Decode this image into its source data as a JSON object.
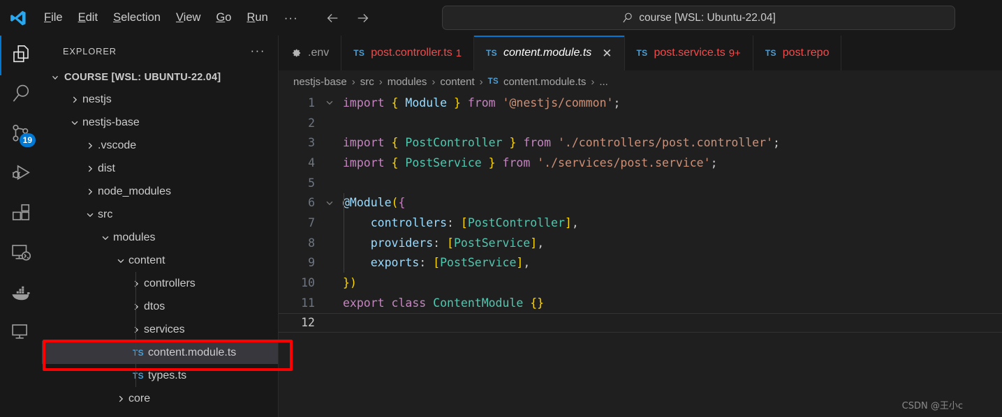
{
  "titlebar": {
    "logo_icon": "vscode-logo-icon",
    "menu": [
      {
        "label": "File",
        "access_key": "F"
      },
      {
        "label": "Edit",
        "access_key": "E"
      },
      {
        "label": "Selection",
        "access_key": "S"
      },
      {
        "label": "View",
        "access_key": "V"
      },
      {
        "label": "Go",
        "access_key": "G"
      },
      {
        "label": "Run",
        "access_key": "R"
      }
    ],
    "overflow_label": "···",
    "back_icon": "arrow-left-icon",
    "forward_icon": "arrow-right-icon",
    "command_center": {
      "search_icon": "search-icon",
      "text": "course [WSL: Ubuntu-22.04]"
    }
  },
  "activity_bar": {
    "items": [
      {
        "name": "explorer",
        "icon": "files-icon",
        "active": true,
        "badge": ""
      },
      {
        "name": "search",
        "icon": "search-icon",
        "active": false,
        "badge": ""
      },
      {
        "name": "source-control",
        "icon": "source-control-icon",
        "active": false,
        "badge": "19"
      },
      {
        "name": "run-and-debug",
        "icon": "debug-icon",
        "active": false,
        "badge": ""
      },
      {
        "name": "extensions",
        "icon": "extensions-icon",
        "active": false,
        "badge": ""
      },
      {
        "name": "remote-explorer",
        "icon": "remote-explorer-icon",
        "active": false,
        "badge": ""
      },
      {
        "name": "docker",
        "icon": "docker-whale-icon",
        "active": false,
        "badge": ""
      },
      {
        "name": "testing",
        "icon": "screen-icon",
        "active": false,
        "badge": ""
      }
    ]
  },
  "sidebar": {
    "header_title": "EXPLORER",
    "more_actions_label": "···",
    "root_folder": "COURSE [WSL: UBUNTU-22.04]",
    "tree": [
      {
        "label": "nestjs",
        "depth": 1,
        "kind": "folder",
        "state": "collapsed",
        "selected": false
      },
      {
        "label": "nestjs-base",
        "depth": 1,
        "kind": "folder",
        "state": "expanded",
        "selected": false
      },
      {
        "label": ".vscode",
        "depth": 2,
        "kind": "folder",
        "state": "collapsed",
        "selected": false
      },
      {
        "label": "dist",
        "depth": 2,
        "kind": "folder",
        "state": "collapsed",
        "selected": false
      },
      {
        "label": "node_modules",
        "depth": 2,
        "kind": "folder",
        "state": "collapsed",
        "selected": false
      },
      {
        "label": "src",
        "depth": 2,
        "kind": "folder",
        "state": "expanded",
        "selected": false
      },
      {
        "label": "modules",
        "depth": 3,
        "kind": "folder",
        "state": "expanded",
        "selected": false
      },
      {
        "label": "content",
        "depth": 4,
        "kind": "folder",
        "state": "expanded",
        "selected": false
      },
      {
        "label": "controllers",
        "depth": 5,
        "kind": "folder",
        "state": "collapsed",
        "selected": false
      },
      {
        "label": "dtos",
        "depth": 5,
        "kind": "folder",
        "state": "collapsed",
        "selected": false
      },
      {
        "label": "services",
        "depth": 5,
        "kind": "folder",
        "state": "collapsed",
        "selected": false
      },
      {
        "label": "content.module.ts",
        "depth": 5,
        "kind": "file",
        "icon": "TS",
        "selected": true
      },
      {
        "label": "types.ts",
        "depth": 5,
        "kind": "file",
        "icon": "TS",
        "selected": false
      },
      {
        "label": "core",
        "depth": 4,
        "kind": "folder",
        "state": "collapsed",
        "selected": false
      }
    ]
  },
  "tabs": [
    {
      "label": ".env",
      "icon": "gear-icon",
      "active": false,
      "error": false,
      "count": "",
      "closeable": false
    },
    {
      "label": "post.controller.ts",
      "icon": "TS",
      "active": false,
      "error": true,
      "count": "1",
      "closeable": false
    },
    {
      "label": "content.module.ts",
      "icon": "TS",
      "active": true,
      "error": false,
      "count": "",
      "closeable": true,
      "close_label": "✕"
    },
    {
      "label": "post.service.ts",
      "icon": "TS",
      "active": false,
      "error": true,
      "count": "9+",
      "closeable": false
    },
    {
      "label": "post.repo",
      "icon": "TS",
      "active": false,
      "error": true,
      "count": "",
      "closeable": false
    }
  ],
  "breadcrumb": {
    "separator": "›",
    "items": [
      "nestjs-base",
      "src",
      "modules",
      "content"
    ],
    "file_icon": "TS",
    "file": "content.module.ts",
    "trailing": "..."
  },
  "editor": {
    "language": "typescript",
    "active_line": 12,
    "lines": [
      {
        "n": 1,
        "foldable": true
      },
      {
        "n": 2,
        "foldable": false
      },
      {
        "n": 3,
        "foldable": false
      },
      {
        "n": 4,
        "foldable": false
      },
      {
        "n": 5,
        "foldable": false
      },
      {
        "n": 6,
        "foldable": true
      },
      {
        "n": 7,
        "foldable": false
      },
      {
        "n": 8,
        "foldable": false
      },
      {
        "n": 9,
        "foldable": false
      },
      {
        "n": 10,
        "foldable": false
      },
      {
        "n": 11,
        "foldable": false
      },
      {
        "n": 12,
        "foldable": false
      }
    ],
    "text": [
      "import { Module } from '@nestjs/common';",
      "",
      "import { PostController } from './controllers/post.controller';",
      "import { PostService } from './services/post.service';",
      "",
      "@Module({",
      "    controllers: [PostController],",
      "    providers: [PostService],",
      "    exports: [PostService],",
      "})",
      "export class ContentModule {}",
      ""
    ]
  },
  "annotation": {
    "target": "content.module.ts",
    "color": "#ff0000"
  },
  "watermark": "CSDN @王小c",
  "colors": {
    "accent": "#0078d4",
    "error": "#f14c4c",
    "editor_bg": "#1f1f1f",
    "chrome_bg": "#181818",
    "selection_bg": "#37373d",
    "badge_bg": "#0078d4"
  }
}
